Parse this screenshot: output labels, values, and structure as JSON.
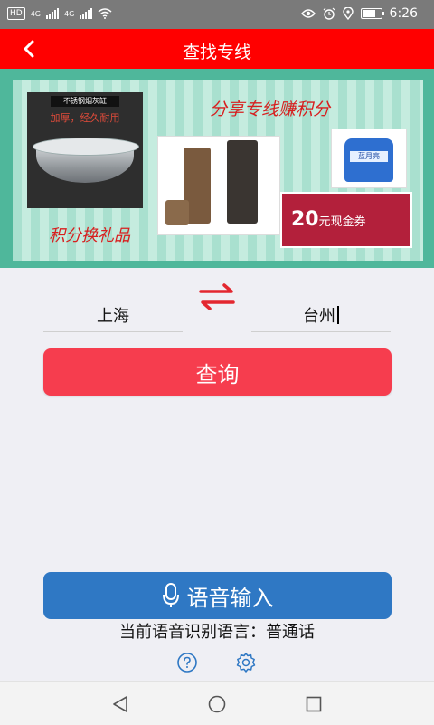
{
  "status_bar": {
    "hd_badge": "HD",
    "network_1": "4G",
    "network_2": "4G",
    "time": "6:26",
    "icons": [
      "hd-icon",
      "signal-icon",
      "signal-icon",
      "wifi-icon",
      "eye-icon",
      "alarm-icon",
      "location-icon",
      "battery-icon"
    ],
    "battery_level": 0.7
  },
  "header": {
    "back_icon": "chevron-left-icon",
    "title": "查找专线"
  },
  "banner": {
    "heading": "分享专线赚积分",
    "footer": "积分换礼品",
    "ashtray_label": "不锈钢烟灰缸",
    "ashtray_subtitle": "加厚，经久耐用",
    "bottle_label": "蓝月亮",
    "coupon_amount": "20",
    "coupon_text": "元现金券"
  },
  "route": {
    "from": "上海",
    "to": "台州",
    "swap_icon": "swap-arrows-icon"
  },
  "query_button": {
    "label": "查询"
  },
  "voice": {
    "button_label": "语音输入",
    "mic_icon": "microphone-icon",
    "language_text": "当前语音识别语言：普通话"
  },
  "bottom_icons": {
    "help": "help-icon",
    "settings": "gear-icon"
  },
  "nav_bar": {
    "back": "triangle-back-icon",
    "home": "circle-home-icon",
    "recent": "square-recent-icon"
  },
  "colors": {
    "header_red": "#ff0000",
    "query_button": "#f63d4e",
    "voice_button": "#2f78c4",
    "swap_arrows": "#e3272f",
    "background": "#efeff4"
  }
}
